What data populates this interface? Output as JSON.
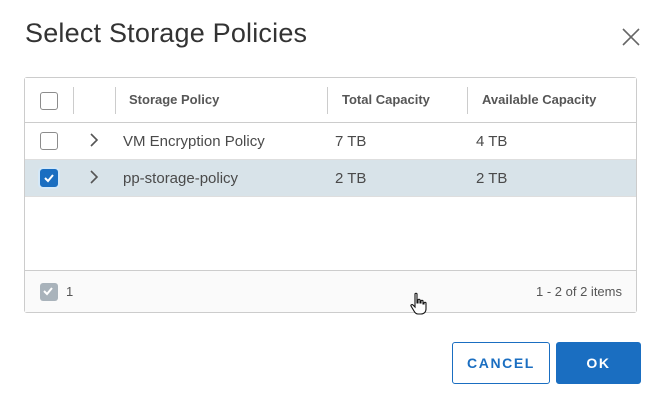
{
  "dialog": {
    "title": "Select Storage Policies",
    "close_icon": "close-icon"
  },
  "grid": {
    "columns": [
      "Storage Policy",
      "Total Capacity",
      "Available Capacity"
    ],
    "select_all_checked": false,
    "rows": [
      {
        "name": "VM Encryption Policy",
        "total": "7 TB",
        "available": "4 TB",
        "checked": false
      },
      {
        "name": "pp-storage-policy",
        "total": "2 TB",
        "available": "2 TB",
        "checked": true
      }
    ],
    "footer": {
      "selected_count": "1",
      "pagination": "1 - 2 of 2 items"
    }
  },
  "buttons": {
    "cancel_label": "CANCEL",
    "ok_label": "OK"
  },
  "colors": {
    "accent": "#1a6ec1",
    "selected_row": "#d8e3e9"
  }
}
